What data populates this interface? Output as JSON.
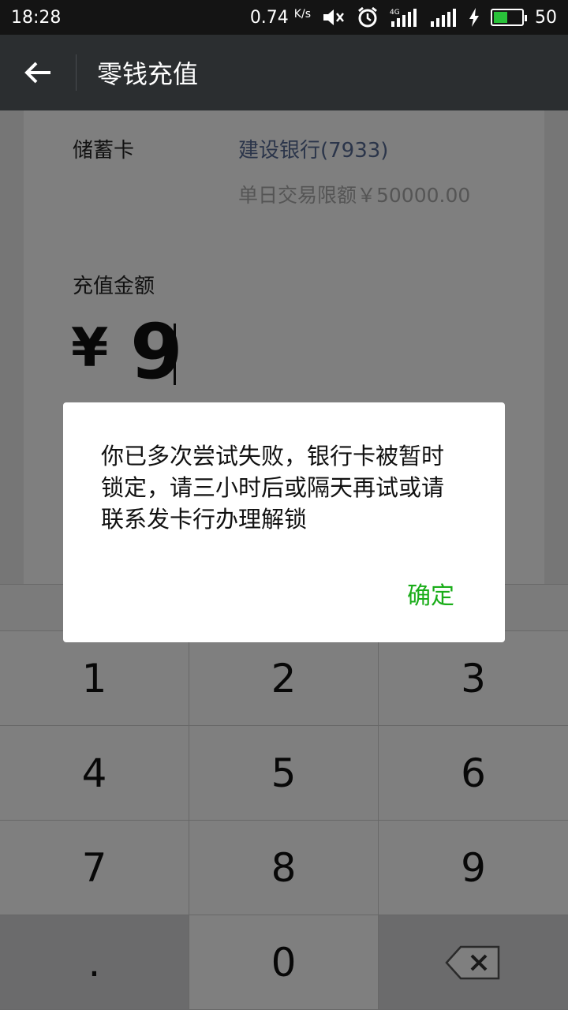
{
  "status_bar": {
    "time": "18:28",
    "net_speed": "0.74",
    "net_unit": "K/s",
    "network_type": "4G",
    "battery_level": "50",
    "icons": [
      "mute-icon",
      "alarm-icon",
      "signal-4g-icon",
      "signal-icon",
      "charging-icon",
      "battery-icon"
    ]
  },
  "action_bar": {
    "title": "零钱充值",
    "back_icon": "back-arrow-icon"
  },
  "form": {
    "card_label": "储蓄卡",
    "bank_name": "建设银行(7933)",
    "limit_text": "单日交易限额￥50000.00",
    "amount_label": "充值金额",
    "currency_symbol": "¥",
    "amount_value": "9"
  },
  "keypad": {
    "keys": [
      "1",
      "2",
      "3",
      "4",
      "5",
      "6",
      "7",
      "8",
      "9",
      ".",
      "0"
    ],
    "delete_icon": "backspace-icon"
  },
  "dialog": {
    "message": "你已多次尝试失败，银行卡被暂时锁定，请三小时后或隔天再试或请联系发卡行办理解锁",
    "confirm_label": "确定"
  },
  "colors": {
    "status_bar_bg": "#141414",
    "action_bar_bg": "#2b2e30",
    "link_blue": "#576b95",
    "confirm_green": "#1aad19",
    "battery_green": "#29c23a"
  }
}
